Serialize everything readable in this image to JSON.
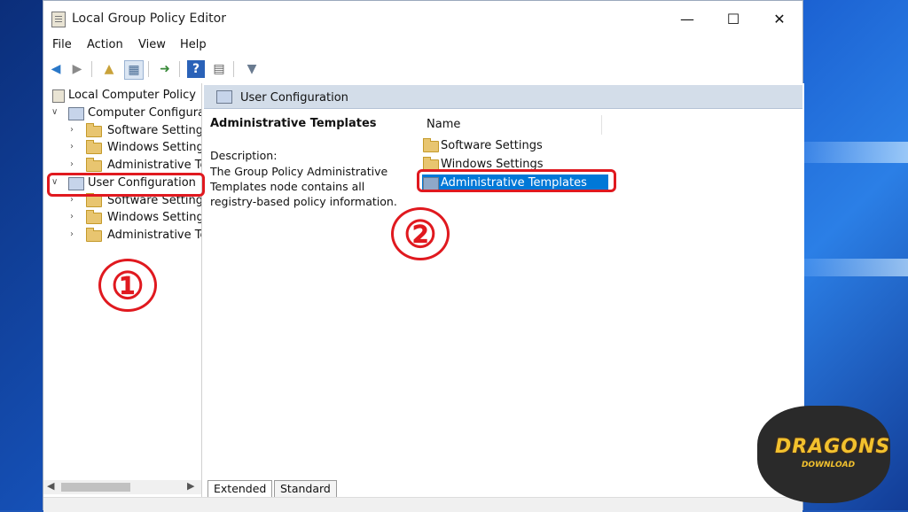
{
  "window": {
    "title": "Local Group Policy Editor",
    "controls": {
      "minimize": "—",
      "maximize": "☐",
      "close": "✕"
    }
  },
  "menu": {
    "items": [
      {
        "label": "File"
      },
      {
        "label": "Action"
      },
      {
        "label": "View"
      },
      {
        "label": "Help"
      }
    ]
  },
  "toolbar": {
    "icons": [
      "back-arrow-icon",
      "forward-arrow-icon",
      "up-folder-icon",
      "show-hide-tree-icon",
      "export-list-icon",
      "help-icon",
      "properties-icon",
      "filter-icon"
    ]
  },
  "tree": {
    "root": {
      "label": "Local Computer Policy"
    },
    "computer": {
      "label": "Computer Configura",
      "children": [
        {
          "label": "Software Settings"
        },
        {
          "label": "Windows Setting"
        },
        {
          "label": "Administrative Te"
        }
      ]
    },
    "user": {
      "label": "User Configuration",
      "children": [
        {
          "label": "Software Settings"
        },
        {
          "label": "Windows Setting"
        },
        {
          "label": "Administrative Te"
        }
      ]
    }
  },
  "details": {
    "header": "User Configuration",
    "selected_title": "Administrative Templates",
    "description_label": "Description:",
    "description_text": "The Group Policy Administrative Templates node contains all registry-based policy information.",
    "column_name": "Name",
    "items": [
      {
        "label": "Software Settings",
        "selected": false
      },
      {
        "label": "Windows Settings",
        "selected": false
      },
      {
        "label": "Administrative Templates",
        "selected": true
      }
    ]
  },
  "tabs": [
    {
      "label": "Extended",
      "active": true
    },
    {
      "label": "Standard",
      "active": false
    }
  ],
  "annotations": {
    "step1": "①",
    "step2": "②",
    "color": "#e0191f"
  },
  "logo": {
    "main": "DRAGONS",
    "sub": "DOWNLOAD"
  }
}
